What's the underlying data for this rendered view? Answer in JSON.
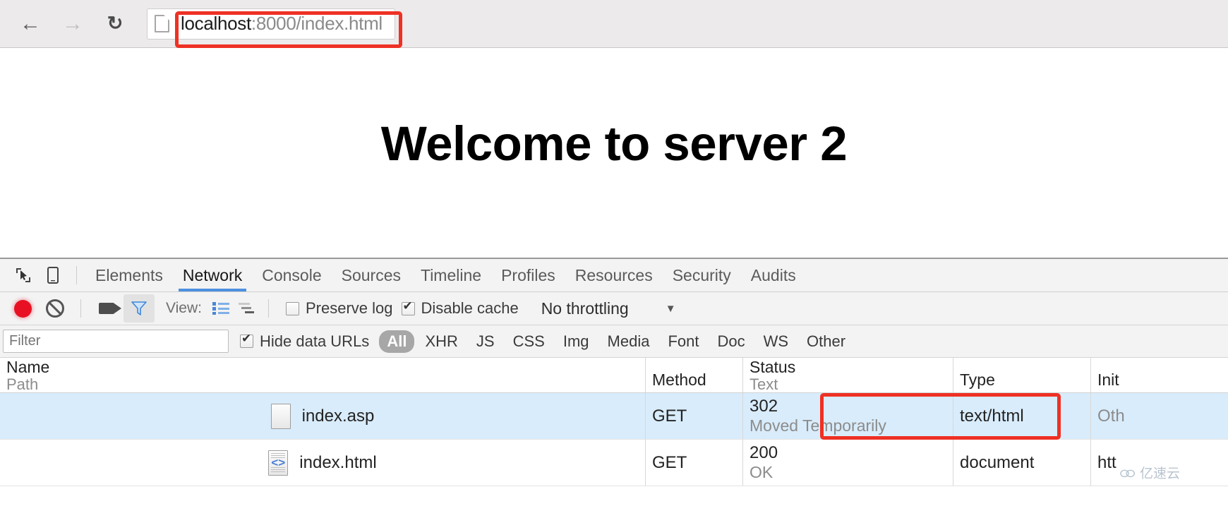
{
  "browser": {
    "back_icon": "back-arrow-icon",
    "forward_icon": "forward-arrow-icon",
    "reload_icon": "reload-icon",
    "url_host": "localhost",
    "url_rest": ":8000/index.html",
    "highlight_color": "#ee3124"
  },
  "page": {
    "heading": "Welcome to server 2"
  },
  "devtools": {
    "tabs": [
      {
        "label": "Elements",
        "active": false
      },
      {
        "label": "Network",
        "active": true
      },
      {
        "label": "Console",
        "active": false
      },
      {
        "label": "Sources",
        "active": false
      },
      {
        "label": "Timeline",
        "active": false
      },
      {
        "label": "Profiles",
        "active": false
      },
      {
        "label": "Resources",
        "active": false
      },
      {
        "label": "Security",
        "active": false
      },
      {
        "label": "Audits",
        "active": false
      }
    ],
    "active_tab_color": "#4d90e0",
    "toolbar": {
      "record_title": "record-button",
      "clear_title": "clear-button",
      "capture_screenshots_title": "camera-button",
      "filter_title": "filter-button",
      "view_label": "View:",
      "view_list_title": "list-view-icon",
      "view_waterfall_title": "waterfall-view-icon",
      "preserve_log_label": "Preserve log",
      "preserve_log_checked": false,
      "disable_cache_label": "Disable cache",
      "disable_cache_checked": true,
      "throttling_value": "No throttling",
      "throttling_arrow": "▼"
    },
    "filterbar": {
      "filter_placeholder": "Filter",
      "filter_value": "",
      "hide_data_urls_label": "Hide data URLs",
      "hide_data_urls_checked": true,
      "types": [
        {
          "label": "All",
          "active": true
        },
        {
          "label": "XHR",
          "active": false
        },
        {
          "label": "JS",
          "active": false
        },
        {
          "label": "CSS",
          "active": false
        },
        {
          "label": "Img",
          "active": false
        },
        {
          "label": "Media",
          "active": false
        },
        {
          "label": "Font",
          "active": false
        },
        {
          "label": "Doc",
          "active": false
        },
        {
          "label": "WS",
          "active": false
        },
        {
          "label": "Other",
          "active": false
        }
      ]
    },
    "table": {
      "headers": {
        "name_main": "Name",
        "name_sub": "Path",
        "method": "Method",
        "status_main": "Status",
        "status_sub": "Text",
        "type": "Type",
        "initiator": "Init"
      },
      "rows": [
        {
          "icon": "file-plain-icon",
          "name": "index.asp",
          "method": "GET",
          "status_code": "302",
          "status_text": "Moved Temporarily",
          "type": "text/html",
          "initiator": "Oth",
          "selected": true,
          "status_highlighted": true
        },
        {
          "icon": "file-code-icon",
          "name": "index.html",
          "method": "GET",
          "status_code": "200",
          "status_text": "OK",
          "type": "document",
          "initiator": "htt",
          "selected": false,
          "status_highlighted": false
        }
      ]
    }
  },
  "watermark": {
    "text": "亿速云"
  }
}
